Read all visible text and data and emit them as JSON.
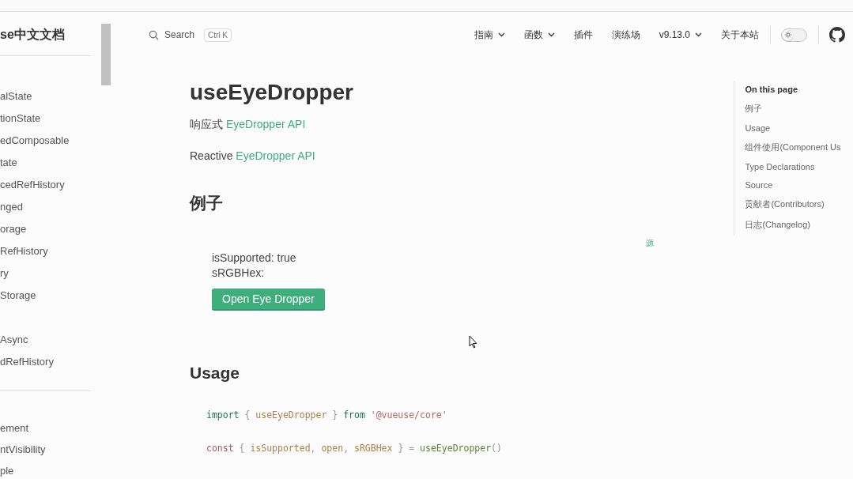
{
  "sidebar": {
    "title": "se中文文档",
    "groups": [
      {
        "items": [
          {
            "label": "alState",
            "selected": false
          },
          {
            "label": "tionState",
            "selected": false
          },
          {
            "label": "edComposable",
            "selected": false
          },
          {
            "label": "tate",
            "selected": false
          },
          {
            "label": "cedRefHistory",
            "selected": false
          },
          {
            "label": "nged",
            "selected": false
          },
          {
            "label": "orage",
            "selected": false
          },
          {
            "label": "RefHistory",
            "selected": false
          },
          {
            "label": "ry",
            "selected": false
          },
          {
            "label": "Storage",
            "selected": false
          }
        ]
      },
      {
        "items": [
          {
            "label": "Async",
            "selected": false
          },
          {
            "label": "dRefHistory",
            "selected": false
          }
        ]
      },
      {
        "items": [
          {
            "label": "ement",
            "selected": false
          },
          {
            "label": "ntVisibility",
            "selected": false
          },
          {
            "label": "ple",
            "selected": false
          }
        ]
      }
    ]
  },
  "search": {
    "label": "Search",
    "shortcut": "Ctrl K"
  },
  "nav": [
    {
      "label": "指南",
      "dropdown": true
    },
    {
      "label": "函数",
      "dropdown": true
    },
    {
      "label": "插件",
      "dropdown": false
    },
    {
      "label": "演练场",
      "dropdown": false
    },
    {
      "label": "v9.13.0",
      "dropdown": true
    },
    {
      "label": "关于本站",
      "dropdown": false
    }
  ],
  "theme_toggle": {
    "on": false
  },
  "page": {
    "title": "useEyeDropper",
    "intro": [
      {
        "text": "响应式",
        "link": "EyeDropper API"
      },
      {
        "text": "Reactive",
        "link": "EyeDropper API"
      }
    ],
    "example_heading": "例子",
    "source_link": "源",
    "demo_lines": [
      "isSupported: true",
      "sRGBHex:"
    ],
    "demo_button": "Open Eye Dropper",
    "usage_heading": "Usage",
    "code": [
      [
        {
          "text": "import",
          "kind": "keyword"
        },
        {
          "text": " { ",
          "kind": "punct"
        },
        {
          "text": "useEyeDropper",
          "kind": "ident"
        },
        {
          "text": " } ",
          "kind": "punct"
        },
        {
          "text": "from",
          "kind": "keyword"
        },
        {
          "text": "'@vueuse/core'",
          "kind": "string"
        }
      ],
      [
        {
          "text": "const",
          "kind": "decl"
        },
        {
          "text": " { ",
          "kind": "punct"
        },
        {
          "text": "isSupported",
          "kind": "ident"
        },
        {
          "text": ", ",
          "kind": "punct"
        },
        {
          "text": "open",
          "kind": "ident"
        },
        {
          "text": ", ",
          "kind": "punct"
        },
        {
          "text": "sRGBHex",
          "kind": "ident"
        },
        {
          "text": " } = ",
          "kind": "punct"
        },
        {
          "text": "useEyeDropper",
          "kind": "call"
        },
        {
          "text": "()",
          "kind": "punct"
        }
      ]
    ]
  },
  "toc": {
    "title": "On this page",
    "items": [
      {
        "label": "例子",
        "selected": false
      },
      {
        "label": "Usage",
        "selected": false
      },
      {
        "label": "组件使用(Component Us",
        "selected": false
      },
      {
        "label": "Type Declarations",
        "selected": false
      },
      {
        "label": "Source",
        "selected": false
      },
      {
        "label": "贡献者(Contributors)",
        "selected": false
      },
      {
        "label": "日志(Changelog)",
        "selected": false
      }
    ]
  }
}
